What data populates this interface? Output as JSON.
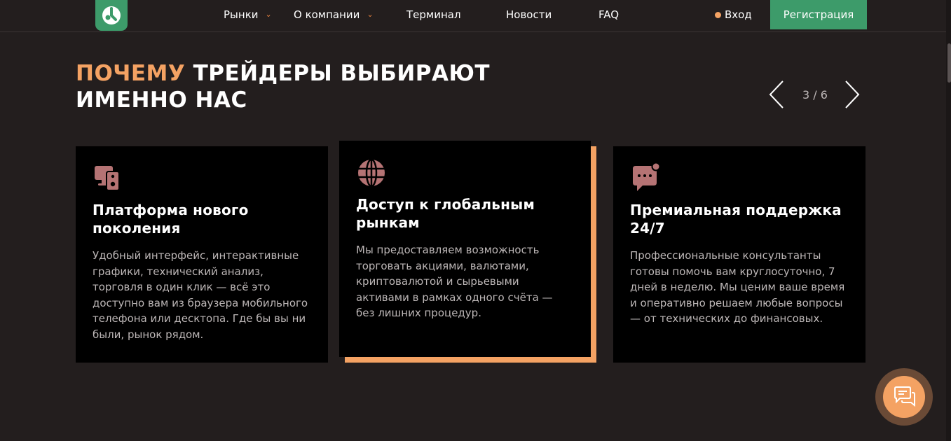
{
  "header": {
    "nav": [
      {
        "label": "Рынки",
        "has_dropdown": true
      },
      {
        "label": "О компании",
        "has_dropdown": true
      },
      {
        "label": "Терминал",
        "has_dropdown": false
      },
      {
        "label": "Новости",
        "has_dropdown": false
      },
      {
        "label": "FAQ",
        "has_dropdown": false
      }
    ],
    "login_label": "Вход",
    "register_label": "Регистрация"
  },
  "section": {
    "title_accent": "ПОЧЕМУ",
    "title_rest_line1": " ТРЕЙДЕРЫ ВЫБИРАЮТ",
    "title_line2": "ИМЕННО НАС",
    "counter": "3 / 6"
  },
  "cards": [
    {
      "icon": "devices-icon",
      "title": "Платформа нового поколения",
      "text": "Удобный интерфейс, интерактивные графики, технический анализ, торговля в один клик — всё это доступно вам из браузера мобильного телефона или десктопа. Где бы вы ни были, рынок рядом."
    },
    {
      "icon": "globe-icon",
      "title": "Доступ к глобальным рынкам",
      "text": "Мы предоставляем возможность торговать акциями, валютами, криптовалютой и сырьевыми активами в рамках одного счёта — без лишних процедур."
    },
    {
      "icon": "chat-bubble-icon",
      "title": "Премиальная поддержка 24/7",
      "text": "Профессиональные консультанты готовы помочь вам круглосуточно, 7 дней в неделю. Мы ценим ваше время и оперативно решаем любые вопросы — от технических до финансовых."
    }
  ],
  "colors": {
    "background": "#231e1e",
    "accent_orange": "#f4a263",
    "brand_green": "#3d9b6a",
    "icon_pink": "#b57374"
  }
}
